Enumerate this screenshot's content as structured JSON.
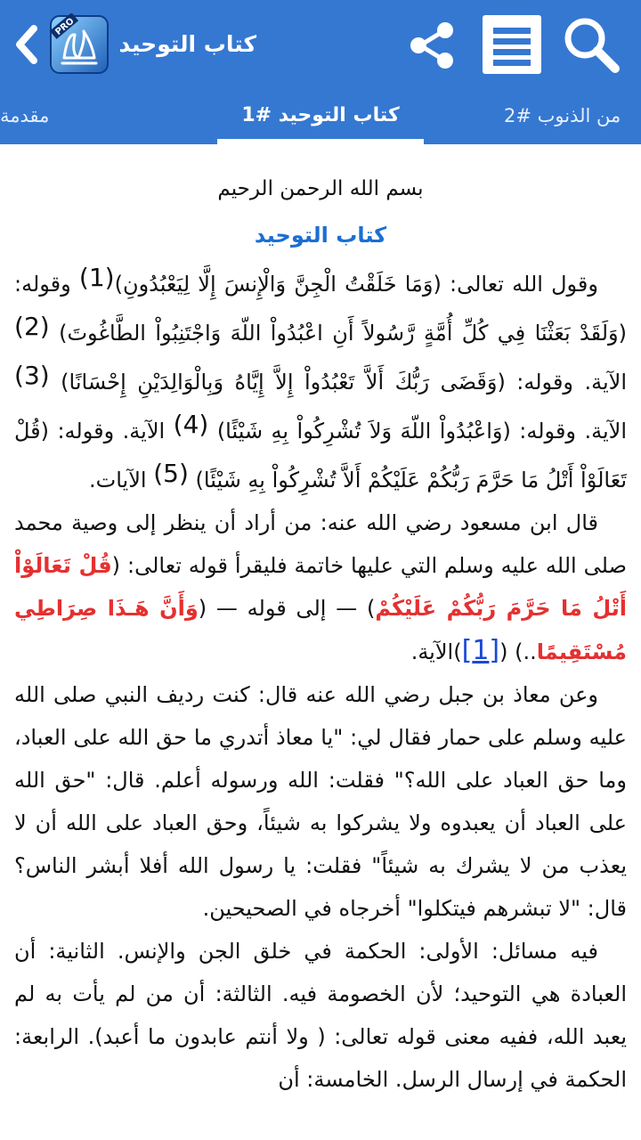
{
  "appbar": {
    "title": "كتاب التوحيد",
    "logo_badge": "PRO",
    "icons": {
      "back": "chevron-left-icon",
      "logo": "allah-calligraphy-logo",
      "share": "share-icon",
      "menu": "list-menu-icon",
      "search": "search-icon"
    },
    "colors": {
      "primary": "#3578d1",
      "icon": "#ffffff"
    }
  },
  "tabs": {
    "left": "مقدمة",
    "center": "كتاب التوحيد #1",
    "right": "من الذنوب #2"
  },
  "content": {
    "basmala": "بسم الله الرحمن الرحيم",
    "chapter_title": "كتاب التوحيد",
    "p1": {
      "a": "وقول الله تعالى: (وَمَا خَلَقْتُ الْجِنَّ وَالْإِنسَ إِلَّا لِيَعْبُدُونِ)",
      "fn1": "(1)",
      "b": " وقوله: (وَلَقَدْ بَعَثْنَا فِي كُلِّ أُمَّةٍ رَّسُولاً أَنِ اعْبُدُواْ اللّهَ وَاجْتَنِبُواْ الطَّاغُوتَ)",
      "fn2": "(2)",
      "c": " الآية. وقوله: (وَقَضَى رَبُّكَ أَلاَّ تَعْبُدُواْ إِلاَّ إِيَّاهُ وَبِالْوَالِدَيْنِ إِحْسَانًا)",
      "fn3": "(3)",
      "d": " الآية. وقوله: (وَاعْبُدُواْ اللّهَ وَلاَ تُشْرِكُواْ بِهِ شَيْئًا)",
      "fn4": "(4)",
      "e": " الآية. وقوله: (قُلْ تَعَالَوْاْ أَتْلُ مَا حَرَّمَ رَبُّكُمْ عَلَيْكُمْ أَلاَّ تُشْرِكُواْ بِهِ شَيْئًا)",
      "fn5": "(5)",
      "f": " الآيات."
    },
    "p2": {
      "a": "قال ابن مسعود رضي الله عنه: من أراد أن ينظر إلى وصية محمد صلى الله عليه وسلم التي عليها خاتمة فليقرأ قوله تعالى: (",
      "hl1": "قُلْ تَعَالَوْاْ أَتْلُ مَا حَرَّمَ رَبُّكُمْ عَلَيْكُمْ",
      "b": ") — إلى قوله — (",
      "hl2": "وَأَنَّ هَـذَا صِرَاطِي مُسْتَقِيمًا",
      "c": "..) (",
      "ref": "[1]",
      "d": ")الآية."
    },
    "p3": "وعن معاذ بن جبل رضي الله عنه قال: كنت رديف النبي صلى الله عليه وسلم على حمار فقال لي: \"يا معاذ أتدري ما حق الله على العباد، وما حق العباد على الله؟\" فقلت: الله ورسوله أعلم. قال: \"حق الله على العباد أن يعبدوه ولا يشركوا به شيئاً، وحق العباد على الله أن لا يعذب من لا يشرك به شيئاً\" فقلت: يا رسول الله أفلا أبشر الناس؟ قال: \"لا تبشرهم فيتكلوا\" أخرجاه في الصحيحين.",
    "p4": "فيه مسائل: الأولى: الحكمة في خلق الجن والإنس. الثانية: أن العبادة هي التوحيد؛ لأن الخصومة فيه. الثالثة: أن من لم يأت به لم يعبد الله، ففيه معنى قوله تعالى: ( ولا أنتم عابدون ما أعبد). الرابعة: الحكمة في إرسال الرسل. الخامسة: أن",
    "colors": {
      "title": "#1b6fd1",
      "highlight": "#e53030",
      "link": "#1a49d8"
    }
  }
}
